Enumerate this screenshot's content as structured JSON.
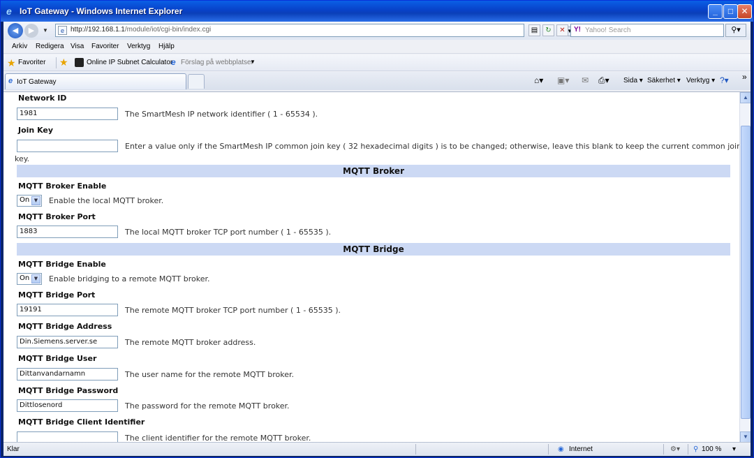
{
  "window": {
    "title": "IoT Gateway - Windows Internet Explorer"
  },
  "address_bar": {
    "url_host": "http://192.168.1.1",
    "url_path": "/module/iot/cgi-bin/index.cgi",
    "search_placeholder": "Yahoo! Search"
  },
  "menu": [
    "Arkiv",
    "Redigera",
    "Visa",
    "Favoriter",
    "Verktyg",
    "Hjälp"
  ],
  "favorites_bar": {
    "favorites_label": "Favoriter",
    "link1": "Online IP Subnet Calculator",
    "link2": "Förslag på webbplatser"
  },
  "tab": {
    "label": "IoT Gateway"
  },
  "command_bar": {
    "page": "Sida",
    "safety": "Säkerhet",
    "tools": "Verktyg"
  },
  "form": {
    "network_id": {
      "label": "Network ID",
      "value": "1981",
      "desc": "The SmartMesh IP network identifier ( 1 - 65534 )."
    },
    "join_key": {
      "label": "Join Key",
      "value": "",
      "desc": "Enter a value only if the SmartMesh IP common join key ( 32 hexadecimal digits ) is to be changed; otherwise, leave this blank to keep the current common join",
      "desc_cont": "key."
    },
    "mqtt_broker_header": "MQTT Broker",
    "broker_enable": {
      "label": "MQTT Broker Enable",
      "value": "On",
      "desc": "Enable the local MQTT broker."
    },
    "broker_port": {
      "label": "MQTT Broker Port",
      "value": "1883",
      "desc": "The local MQTT broker TCP port number ( 1 - 65535 )."
    },
    "mqtt_bridge_header": "MQTT Bridge",
    "bridge_enable": {
      "label": "MQTT Bridge Enable",
      "value": "On",
      "desc": "Enable bridging to a remote MQTT broker."
    },
    "bridge_port": {
      "label": "MQTT Bridge Port",
      "value": "19191",
      "desc": "The remote MQTT broker TCP port number ( 1 - 65535 )."
    },
    "bridge_address": {
      "label": "MQTT Bridge Address",
      "value": "Din.Siemens.server.se",
      "desc": "The remote MQTT broker address."
    },
    "bridge_user": {
      "label": "MQTT Bridge User",
      "value": "Dittanvandarnamn",
      "desc": "The user name for the remote MQTT broker."
    },
    "bridge_password": {
      "label": "MQTT Bridge Password",
      "value": "Dittlosenord",
      "desc": "The password for the remote MQTT broker."
    },
    "bridge_client_id": {
      "label": "MQTT Bridge Client Identifier",
      "value": "",
      "desc": "The client identifier for the remote MQTT broker."
    }
  },
  "status_bar": {
    "left": "Klar",
    "zone": "Internet",
    "zoom": "100 %"
  }
}
